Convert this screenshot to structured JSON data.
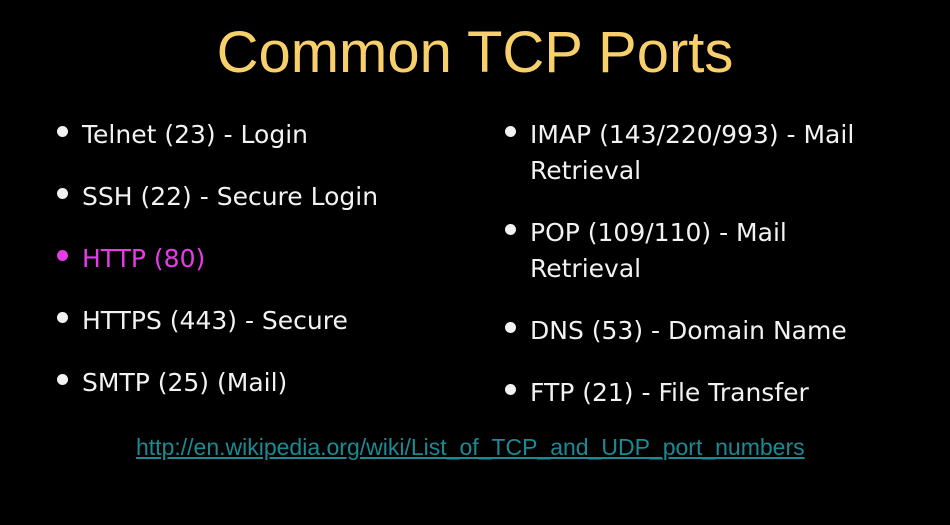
{
  "title": "Common TCP Ports",
  "left": [
    {
      "text": "Telnet (23) - Login",
      "highlighted": false
    },
    {
      "text": "SSH (22) - Secure Login",
      "highlighted": false
    },
    {
      "text": "HTTP (80)",
      "highlighted": true
    },
    {
      "text": "HTTPS (443) - Secure",
      "highlighted": false
    },
    {
      "text": "SMTP (25) (Mail)",
      "highlighted": false
    }
  ],
  "right": [
    {
      "line1": "IMAP (143/220/993) - Mail",
      "line2": "Retrieval"
    },
    {
      "line1": "POP (109/110) - Mail",
      "line2": "Retrieval"
    },
    {
      "line1": "DNS (53) - Domain Name"
    },
    {
      "line1": "FTP (21) - File Transfer"
    }
  ],
  "link": "http://en.wikipedia.org/wiki/List_of_TCP_and_UDP_port_numbers",
  "colors": {
    "title": "#f7cf6b",
    "text": "#f2f2f2",
    "highlight": "#e43ce6",
    "link": "#1b8a93",
    "background": "#000000"
  }
}
